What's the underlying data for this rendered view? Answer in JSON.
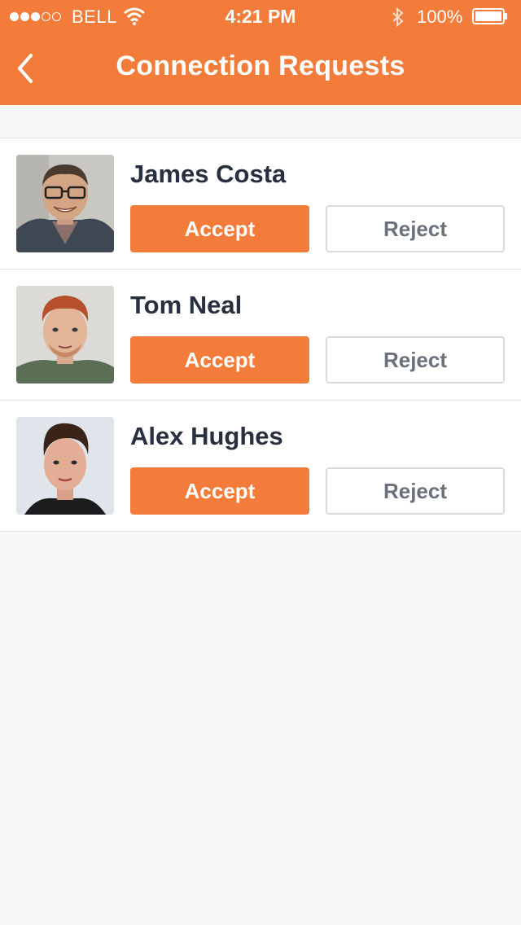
{
  "status_bar": {
    "carrier": "BELL",
    "time": "4:21 PM",
    "battery": "100%",
    "signal_bars_filled": 3,
    "signal_bars_total": 5,
    "icons": [
      "signal-dots",
      "wifi-icon",
      "bluetooth-icon",
      "battery-icon"
    ]
  },
  "header": {
    "title": "Connection Requests",
    "back_icon": "chevron-left-icon"
  },
  "colors": {
    "accent": "#f37c3b",
    "background": "#f6f7f9",
    "name_text": "#283040",
    "reject_text": "#6b717b"
  },
  "requests": [
    {
      "name": "James Costa",
      "accept_label": "Accept",
      "reject_label": "Reject"
    },
    {
      "name": "Tom Neal",
      "accept_label": "Accept",
      "reject_label": "Reject"
    },
    {
      "name": "Alex Hughes",
      "accept_label": "Accept",
      "reject_label": "Reject"
    }
  ]
}
